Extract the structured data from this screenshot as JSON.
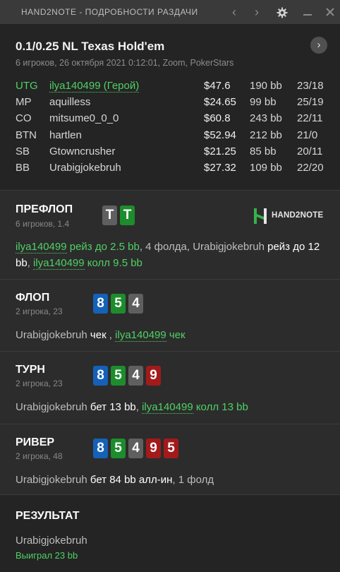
{
  "window": {
    "title": "HAND2NOTE - ПОДРОБНОСТИ РАЗДАЧИ",
    "prev_glyph": "‹",
    "next_glyph": "›",
    "icons": [
      "chevron-left-icon",
      "chevron-right-icon",
      "gear-icon",
      "minimize-icon",
      "close-icon"
    ]
  },
  "hand": {
    "title": "0.1/0.25 NL Texas Hold'em",
    "subtitle": "6 игроков, 26 октября 2021 0:12:01, Zoom, PokerStars",
    "next_glyph": "›"
  },
  "players": [
    {
      "pos": "UTG",
      "name": "ilya140499 (Герой)",
      "stack": "$47.6",
      "bb": "190 bb",
      "stat": "23/18",
      "hero": true
    },
    {
      "pos": "MP",
      "name": "aquilless",
      "stack": "$24.65",
      "bb": "99 bb",
      "stat": "25/19",
      "hero": false
    },
    {
      "pos": "CO",
      "name": "mitsume0_0_0",
      "stack": "$60.8",
      "bb": "243 bb",
      "stat": "22/11",
      "hero": false
    },
    {
      "pos": "BTN",
      "name": "hartlen",
      "stack": "$52.94",
      "bb": "212 bb",
      "stat": "21/0",
      "hero": false
    },
    {
      "pos": "SB",
      "name": "Gtowncrusher",
      "stack": "$21.25",
      "bb": "85 bb",
      "stat": "20/11",
      "hero": false
    },
    {
      "pos": "BB",
      "name": "Urabigjokebruh",
      "stack": "$27.32",
      "bb": "109 bb",
      "stat": "22/20",
      "hero": false
    }
  ],
  "colors": {
    "hero": "#4fd165",
    "card_grey": "#5f5f5f",
    "card_green": "#1d8c2d",
    "card_blue": "#1561b7",
    "card_red": "#a31a1a"
  },
  "preflop": {
    "title": "ПРЕФЛОП",
    "sub": "6 игроков, 1.4",
    "cards": [
      "T",
      "T"
    ],
    "logo": "HAND2NOTE",
    "a1": "ilya140499",
    "a2": "рейз до 2.5 bb",
    "a3": ", 4 фолда, ",
    "a4": "Urabigjokebruh",
    "a5": "рейз до 12 bb",
    "a6": ", ",
    "a7": "ilya140499",
    "a8": "колл 9.5 bb"
  },
  "flop": {
    "title": "ФЛОП",
    "sub": "2 игрока, 23",
    "cards": [
      "8",
      "5",
      "4"
    ],
    "a1": "Urabigjokebruh",
    "a2": "чек",
    "a3": " , ",
    "a4": "ilya140499",
    "a5": "чек"
  },
  "turn": {
    "title": "ТУРН",
    "sub": "2 игрока, 23",
    "cards": [
      "8",
      "5",
      "4",
      "9"
    ],
    "a1": "Urabigjokebruh",
    "a2": "бет 13 bb",
    "a3": ", ",
    "a4": "ilya140499",
    "a5": "колл 13 bb"
  },
  "river": {
    "title": "РИВЕР",
    "sub": "2 игрока, 48",
    "cards": [
      "8",
      "5",
      "4",
      "9",
      "5"
    ],
    "a1": "Urabigjokebruh",
    "a2": "бет 84 bb алл-ин",
    "a3": ", 1 фолд"
  },
  "result": {
    "title": "РЕЗУЛЬТАТ",
    "winner": "Urabigjokebruh",
    "won": "Выиграл 23 bb"
  }
}
